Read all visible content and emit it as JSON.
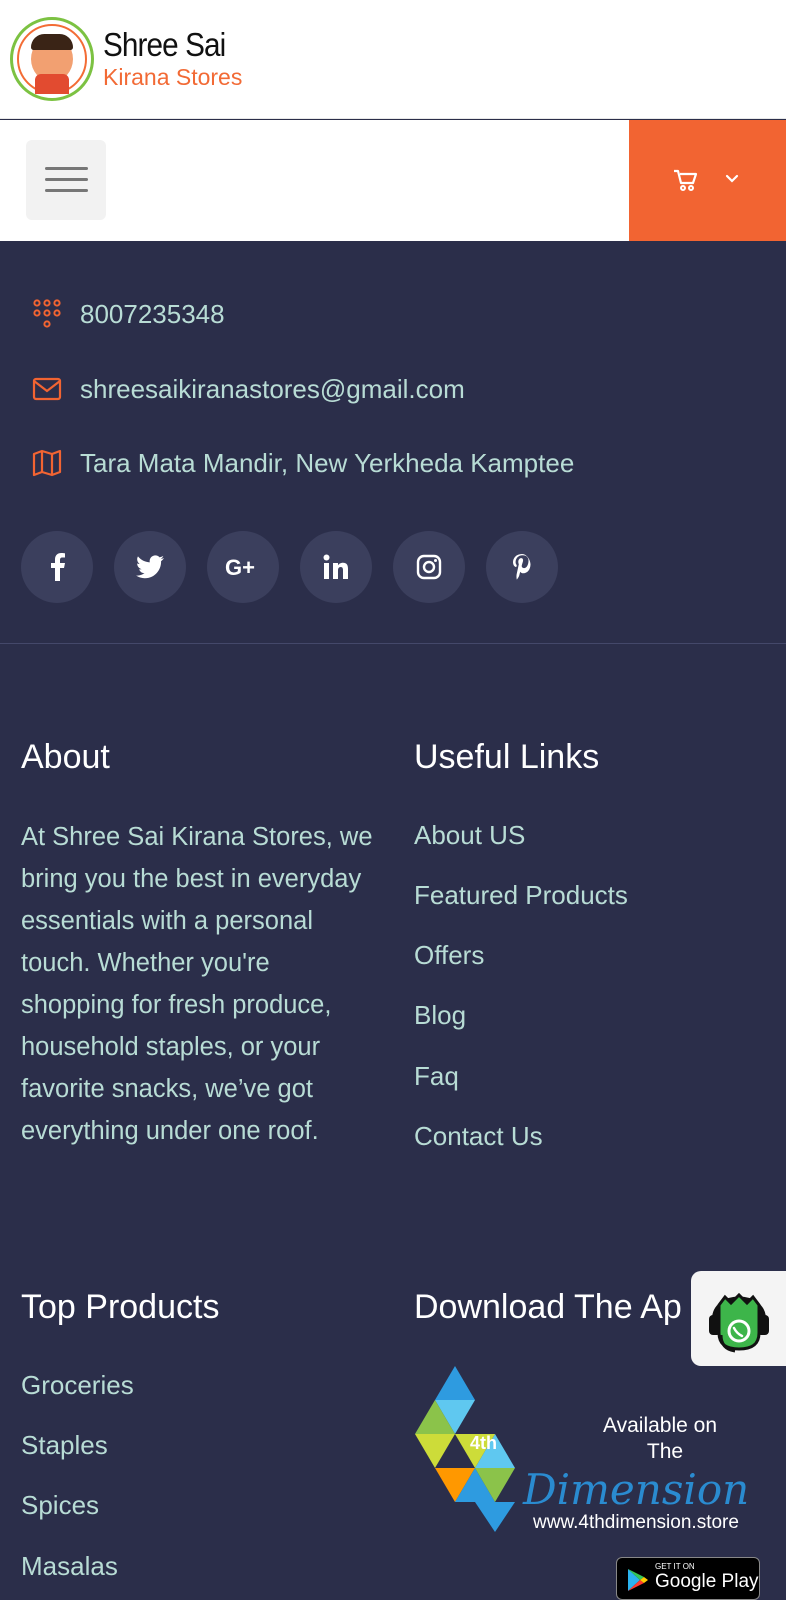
{
  "brand": {
    "name": "Shree Sai",
    "subtitle": "Kirana Stores",
    "logo_text": "SHREE SAI KIRANA STORES"
  },
  "nav": {
    "menu_icon": "hamburger-icon",
    "cart_icon": "cart-icon",
    "cart_dropdown_icon": "chevron-down-icon"
  },
  "contact": {
    "phone": "8007235348",
    "email": "shreesaikiranastores@gmail.com",
    "address": "Tara Mata Mandir, New Yerkheda Kamptee"
  },
  "socials": [
    "facebook-icon",
    "twitter-icon",
    "google-plus-icon",
    "linkedin-icon",
    "instagram-icon",
    "pinterest-icon"
  ],
  "about": {
    "title": "About",
    "text": "At Shree Sai Kirana Stores, we bring you the best in everyday essentials with a personal touch. Whether you're shopping for fresh produce, household staples, or your favorite snacks, we’ve got everything under one roof."
  },
  "useful_links": {
    "title": "Useful Links",
    "items": [
      "About US",
      "Featured Products",
      "Offers",
      "Blog",
      "Faq",
      "Contact Us"
    ]
  },
  "top_products": {
    "title": "Top Products",
    "items": [
      "Groceries",
      "Staples",
      "Spices",
      "Masalas"
    ]
  },
  "download": {
    "title": "Download The Ap",
    "available_on": "Available on",
    "the": "The",
    "brand_mark": "4th",
    "dimension": "Dimension",
    "url": "www.4thdimension.store",
    "gp_small": "GET IT ON",
    "gp_big": "Google Play"
  },
  "colors": {
    "accent": "#f26432",
    "footer_bg": "#2b2e4a",
    "text": "#b8dcd5"
  }
}
